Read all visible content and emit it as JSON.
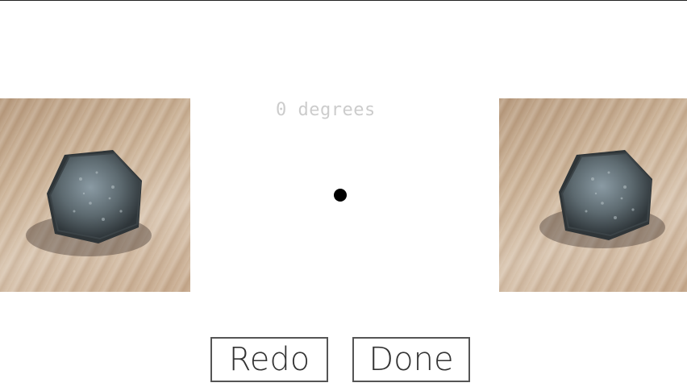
{
  "rotation": {
    "angle_label": "0 degrees"
  },
  "images": {
    "left": {
      "icon": "hex-bolt-photo"
    },
    "right": {
      "icon": "hex-bolt-photo"
    }
  },
  "buttons": {
    "redo_label": "Redo",
    "done_label": "Done"
  },
  "colors": {
    "background": "#ffffff",
    "label": "#cccccc",
    "dot": "#000000",
    "button_border": "#555555"
  }
}
